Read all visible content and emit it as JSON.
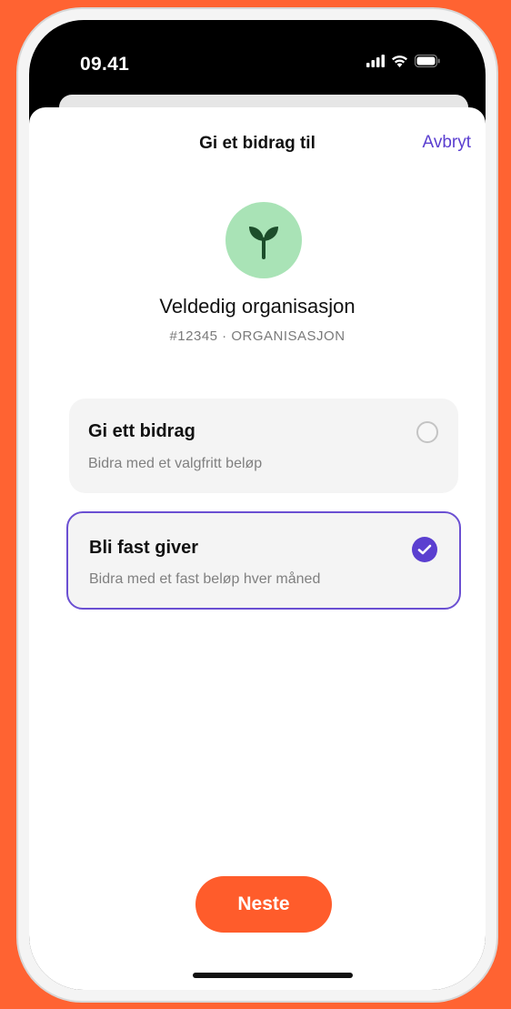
{
  "status_bar": {
    "time": "09.41"
  },
  "header": {
    "title": "Gi et bidrag til",
    "cancel_label": "Avbryt"
  },
  "organization": {
    "icon": "sprout-icon",
    "name": "Veldedig organisasjon",
    "subtitle": "#12345 · ORGANISASJON"
  },
  "options": [
    {
      "title": "Gi ett bidrag",
      "description": "Bidra med et valgfritt beløp",
      "selected": false
    },
    {
      "title": "Bli fast giver",
      "description": "Bidra med et fast beløp hver måned",
      "selected": true
    }
  ],
  "footer": {
    "next_label": "Neste"
  },
  "colors": {
    "background": "#FF6332",
    "accent": "#5B3FD0",
    "primary_button": "#FF5C2B",
    "avatar_bg": "#A9E3B6",
    "icon_green": "#1C4D2A"
  }
}
